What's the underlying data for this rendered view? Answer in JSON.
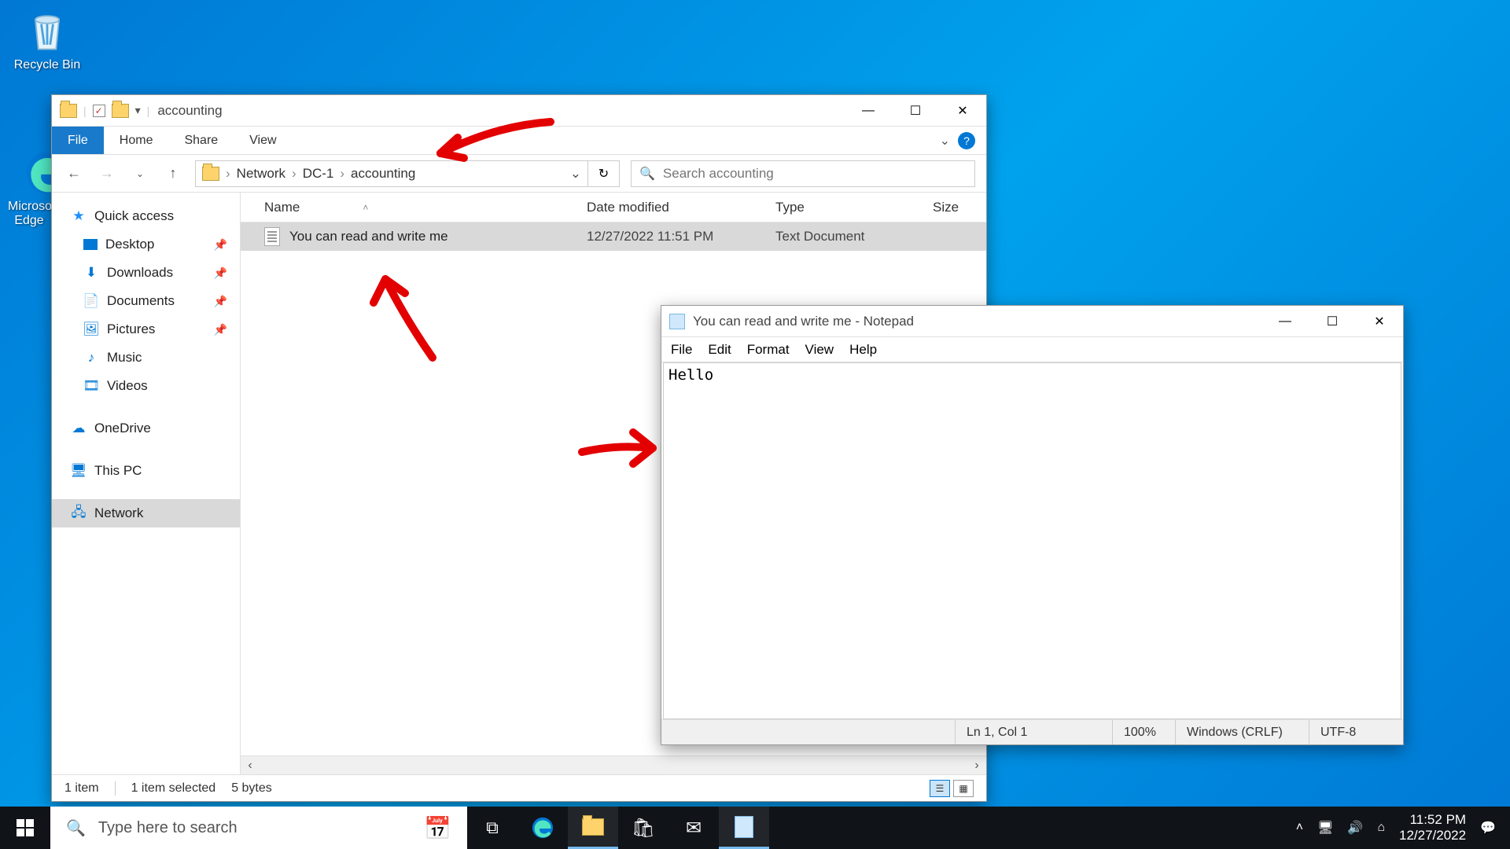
{
  "desktop": {
    "recycle_label": "Recycle Bin",
    "edge_label": "Microsoft Edge"
  },
  "explorer": {
    "title": "accounting",
    "tabs": {
      "file": "File",
      "home": "Home",
      "share": "Share",
      "view": "View"
    },
    "breadcrumb": {
      "root": "Network",
      "host": "DC-1",
      "folder": "accounting"
    },
    "search_placeholder": "Search accounting",
    "nav": {
      "quick": "Quick access",
      "desktop": "Desktop",
      "downloads": "Downloads",
      "documents": "Documents",
      "pictures": "Pictures",
      "music": "Music",
      "videos": "Videos",
      "onedrive": "OneDrive",
      "thispc": "This PC",
      "network": "Network"
    },
    "cols": {
      "name": "Name",
      "date": "Date modified",
      "type": "Type",
      "size": "Size"
    },
    "rows": [
      {
        "name": "You can read and write me",
        "date": "12/27/2022 11:51 PM",
        "type": "Text Document"
      }
    ],
    "status": {
      "count": "1 item",
      "selected": "1 item selected",
      "size": "5 bytes"
    }
  },
  "notepad": {
    "title": "You can read and write me - Notepad",
    "menu": {
      "file": "File",
      "edit": "Edit",
      "format": "Format",
      "view": "View",
      "help": "Help"
    },
    "content": "Hello",
    "status": {
      "pos": "Ln 1, Col 1",
      "zoom": "100%",
      "eol": "Windows (CRLF)",
      "enc": "UTF-8"
    }
  },
  "taskbar": {
    "search_placeholder": "Type here to search",
    "time": "11:52 PM",
    "date": "12/27/2022"
  }
}
